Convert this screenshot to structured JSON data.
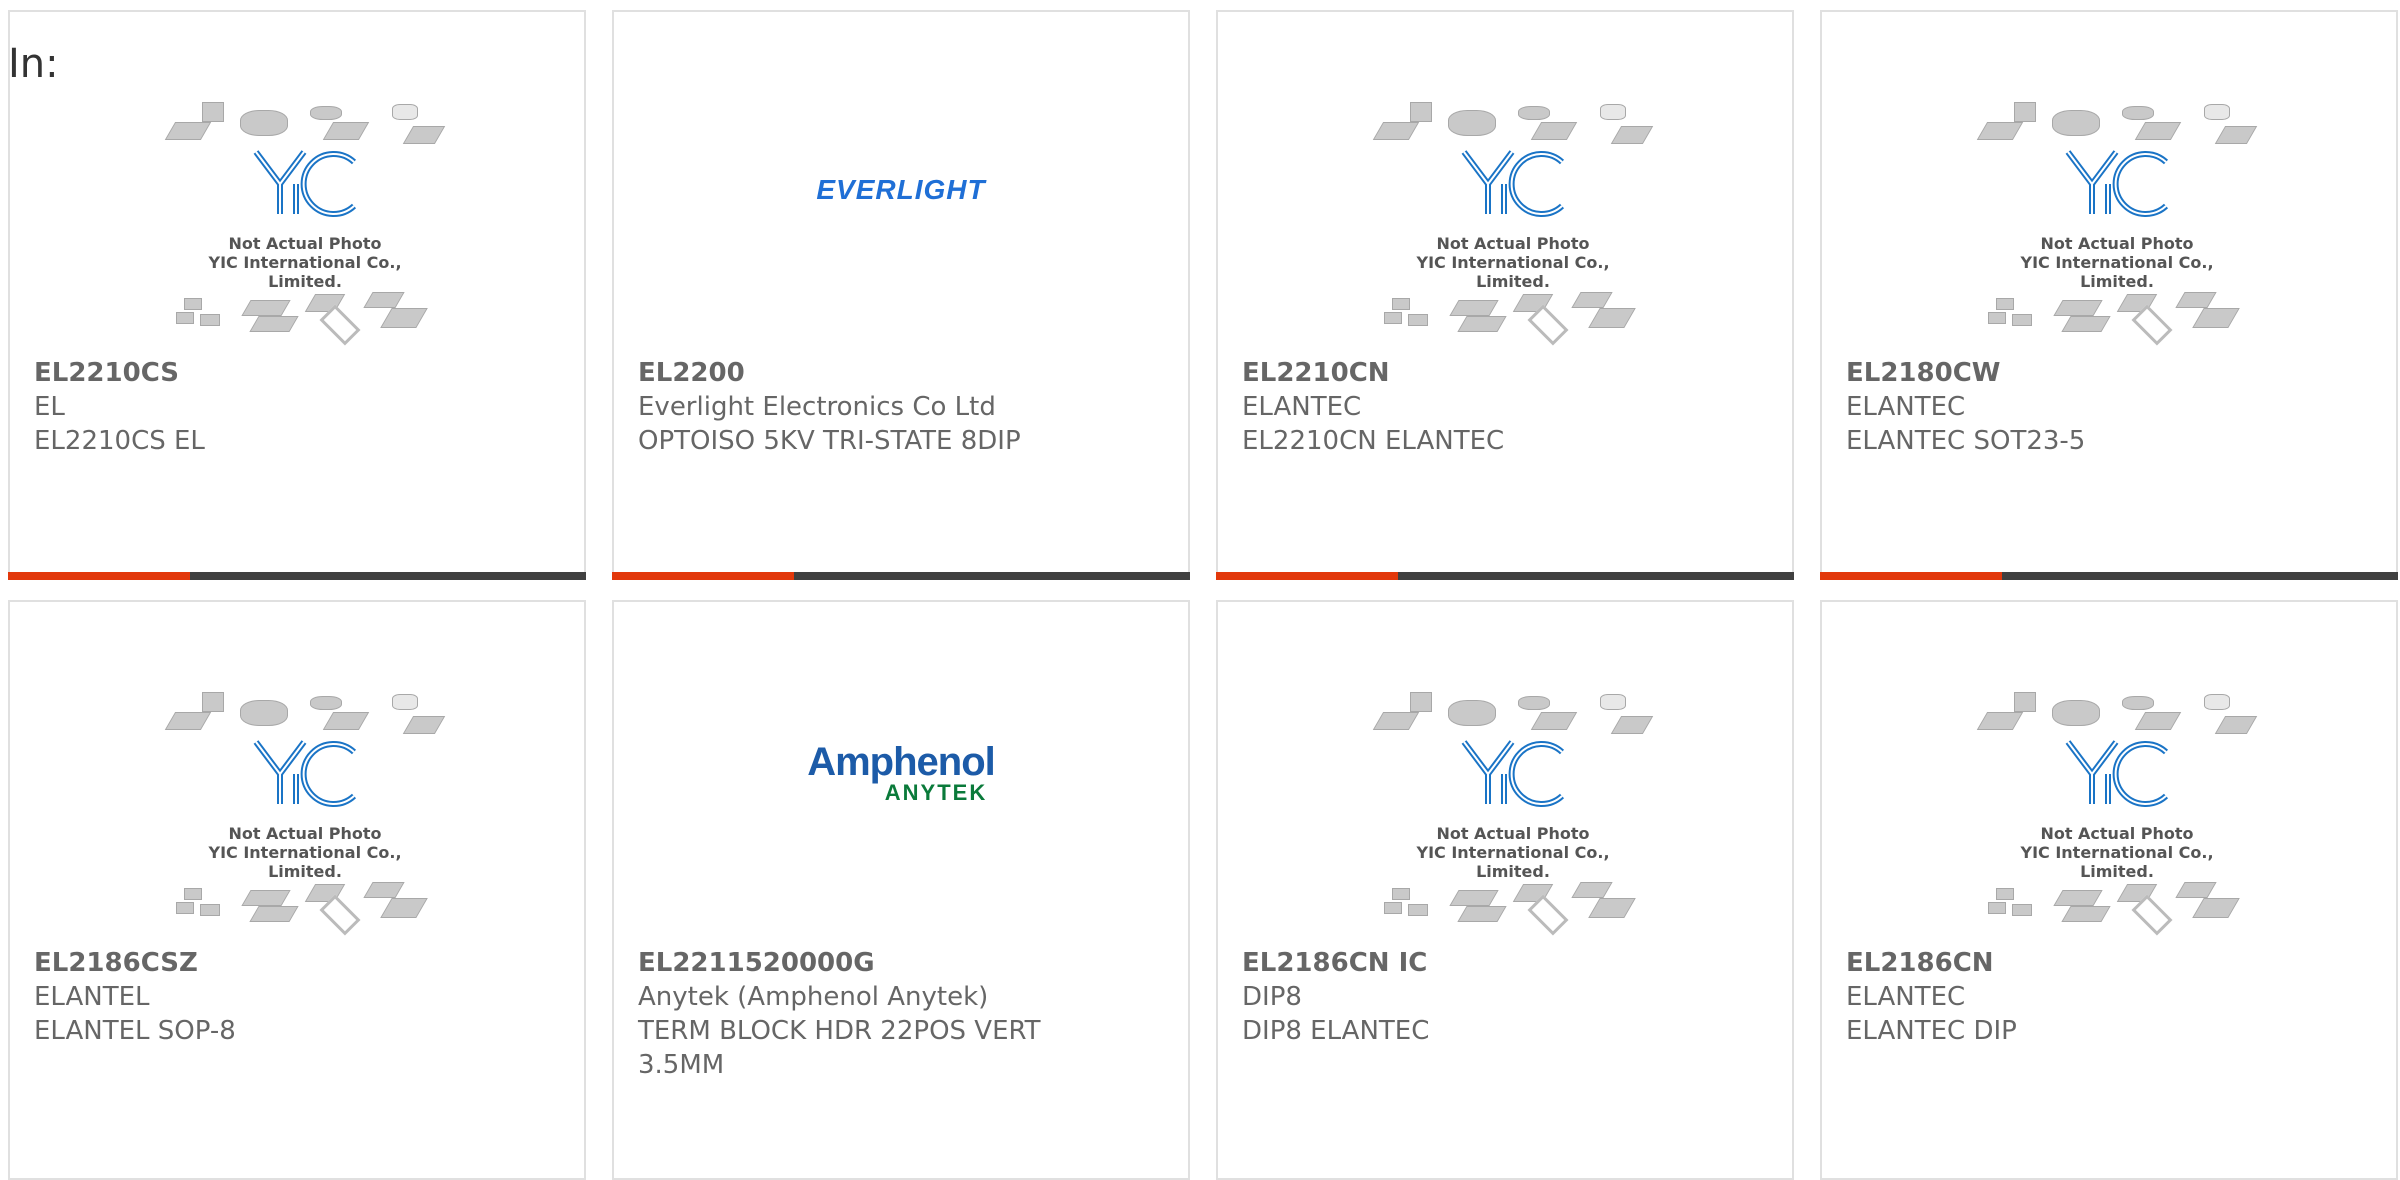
{
  "page": {
    "label": "In:"
  },
  "placeholder": {
    "line1": "Not Actual Photo",
    "line2": "YIC International Co., Limited.",
    "logo_text": "YIC"
  },
  "logos": {
    "everlight": "EVERLIGHT",
    "amphenol_top": "Amphenol",
    "amphenol_bottom": "ANYTEK"
  },
  "colors": {
    "accent": "#e2380b",
    "bar": "#404040",
    "yic_blue": "#1a74c6",
    "everlight_blue": "#1f6fd6",
    "amphenol_blue": "#1c5ba8",
    "anytek_green": "#0a7a3a"
  },
  "products": [
    {
      "part": "EL2210CS",
      "line1": "EL",
      "line2": "EL2210CS EL",
      "line3": "",
      "image": "yic-placeholder"
    },
    {
      "part": "EL2200",
      "line1": "Everlight Electronics Co Ltd",
      "line2": "OPTOISO 5KV TRI-STATE 8DIP",
      "line3": "",
      "image": "everlight-logo"
    },
    {
      "part": "EL2210CN",
      "line1": "ELANTEC",
      "line2": "EL2210CN ELANTEC",
      "line3": "",
      "image": "yic-placeholder"
    },
    {
      "part": "EL2180CW",
      "line1": "ELANTEC",
      "line2": "ELANTEC SOT23-5",
      "line3": "",
      "image": "yic-placeholder"
    },
    {
      "part": "EL2186CSZ",
      "line1": "ELANTEL",
      "line2": "ELANTEL SOP-8",
      "line3": "",
      "image": "yic-placeholder"
    },
    {
      "part": "EL2211520000G",
      "line1": "Anytek (Amphenol Anytek)",
      "line2": "TERM BLOCK HDR 22POS VERT",
      "line3": "3.5MM",
      "image": "amphenol-logo"
    },
    {
      "part": "EL2186CN IC",
      "line1": "DIP8",
      "line2": "DIP8 ELANTEC",
      "line3": "",
      "image": "yic-placeholder"
    },
    {
      "part": "EL2186CN",
      "line1": "ELANTEC",
      "line2": "ELANTEC DIP",
      "line3": "",
      "image": "yic-placeholder"
    }
  ]
}
